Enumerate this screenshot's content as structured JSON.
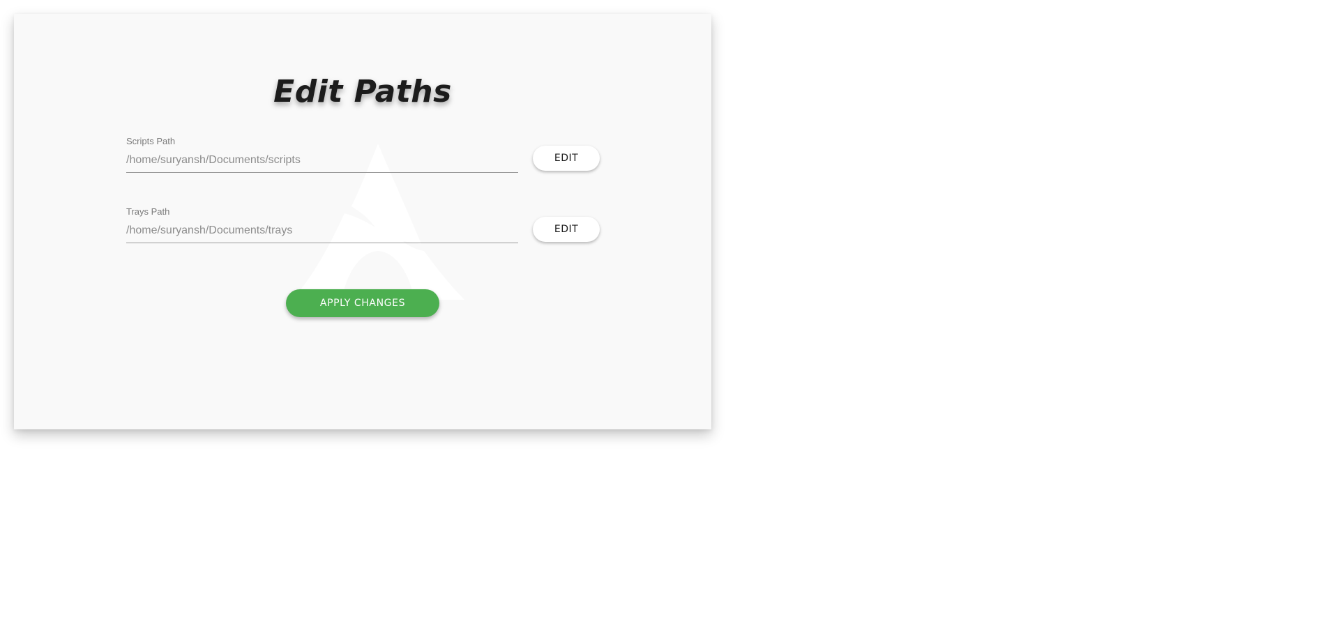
{
  "page": {
    "title": "Edit Paths"
  },
  "fields": {
    "scripts": {
      "label": "Scripts Path",
      "placeholder": "/home/suryansh/Documents/scripts",
      "edit_label": "EDIT"
    },
    "trays": {
      "label": "Trays Path",
      "placeholder": "/home/suryansh/Documents/trays",
      "edit_label": "EDIT"
    }
  },
  "actions": {
    "apply_label": "APPLY CHANGES"
  },
  "colors": {
    "card_background": "#f9f9f9",
    "apply_button": "#4caf50",
    "watermark": "#ffffff"
  },
  "icons": {
    "watermark": "arch-linux-logo-icon"
  }
}
